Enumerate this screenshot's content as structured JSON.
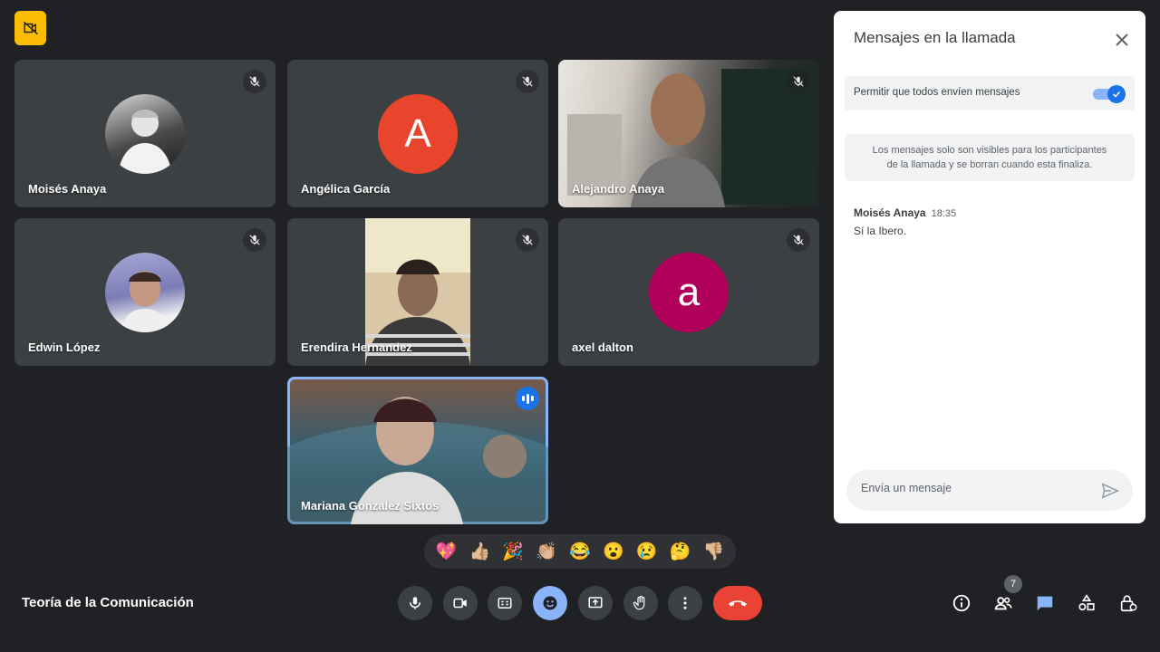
{
  "participants": [
    {
      "name": "Moisés Anaya",
      "avatar_type": "photo",
      "muted": true
    },
    {
      "name": "Angélica García",
      "avatar_letter": "A",
      "avatar_color": "#e8452c",
      "muted": true
    },
    {
      "name": "Alejandro Anaya",
      "avatar_type": "video",
      "muted": true
    },
    {
      "name": "Edwin López",
      "avatar_type": "photo",
      "muted": true
    },
    {
      "name": "Erendira Hernandez",
      "avatar_type": "video",
      "muted": true
    },
    {
      "name": "axel dalton",
      "avatar_letter": "a",
      "avatar_color": "#b0005a",
      "muted": true
    },
    {
      "name": "Mariana Gonzalez Sixtos",
      "avatar_type": "video",
      "speaking": true
    }
  ],
  "chat_panel": {
    "title": "Mensajes en la llamada",
    "allow_label": "Permitir que todos envíen mensajes",
    "allow_enabled": true,
    "note_line1": "Los mensajes solo son visibles para los participantes",
    "note_line2": "de la llamada y se borran cuando esta finaliza.",
    "messages": [
      {
        "sender": "Moisés Anaya",
        "time": "18:35",
        "text": "Sí la Ibero."
      }
    ],
    "compose_placeholder": "Envía un mensaje"
  },
  "reactions": [
    "💖",
    "👍🏼",
    "🎉",
    "👏🏼",
    "😂",
    "😮",
    "😢",
    "🤔",
    "👎🏼"
  ],
  "meeting": {
    "name": "Teoría de la Comunicación"
  },
  "people_count": "7",
  "colors": {
    "accent": "#8ab4f8",
    "hangup": "#ea4335",
    "badge": "#fbbc04"
  }
}
